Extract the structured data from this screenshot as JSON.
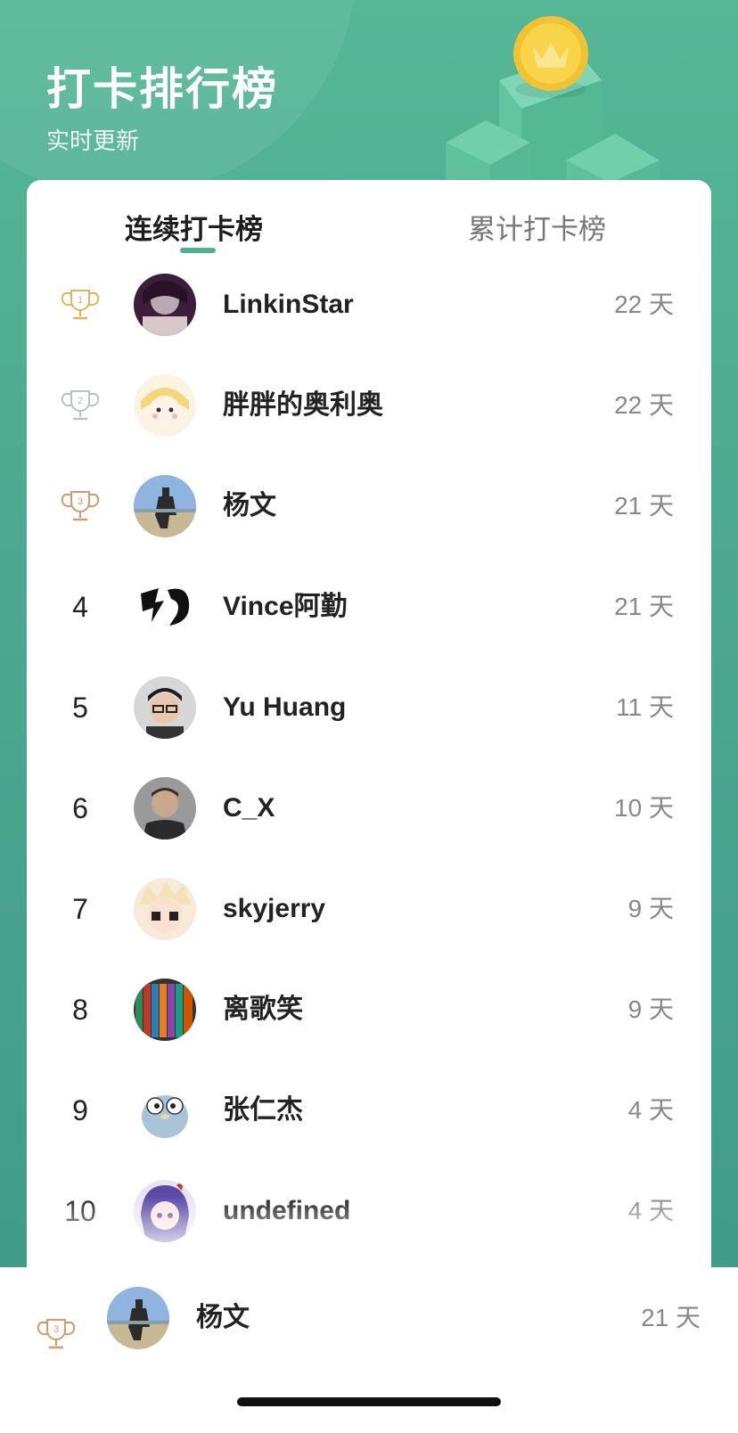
{
  "header": {
    "title": "打卡排行榜",
    "subtitle": "实时更新",
    "accent_color": "#55b796"
  },
  "tabs": [
    {
      "label": "连续打卡榜",
      "active": true
    },
    {
      "label": "累计打卡榜",
      "active": false
    }
  ],
  "ranking": [
    {
      "rank": "1",
      "name": "LinkinStar",
      "days": "22 天",
      "badge": "trophy-gold-icon"
    },
    {
      "rank": "2",
      "name": "胖胖的奥利奥",
      "days": "22 天",
      "badge": "trophy-silver-icon"
    },
    {
      "rank": "3",
      "name": "杨文",
      "days": "21 天",
      "badge": "trophy-bronze-icon"
    },
    {
      "rank": "4",
      "name": "Vince阿勤",
      "days": "21 天"
    },
    {
      "rank": "5",
      "name": "Yu Huang",
      "days": "11 天"
    },
    {
      "rank": "6",
      "name": "C_X",
      "days": "10 天"
    },
    {
      "rank": "7",
      "name": "skyjerry",
      "days": "9 天"
    },
    {
      "rank": "8",
      "name": "离歌笑",
      "days": "9 天"
    },
    {
      "rank": "9",
      "name": "张仁杰",
      "days": "4 天"
    },
    {
      "rank": "10",
      "name": "undefined",
      "days": "4 天"
    }
  ],
  "current_user": {
    "rank": "3",
    "name": "杨文",
    "days": "21 天",
    "badge": "trophy-bronze-icon"
  },
  "trophy_colors": {
    "gold": "#e3b457",
    "silver": "#b8c2cc",
    "bronze": "#d29a6d"
  }
}
